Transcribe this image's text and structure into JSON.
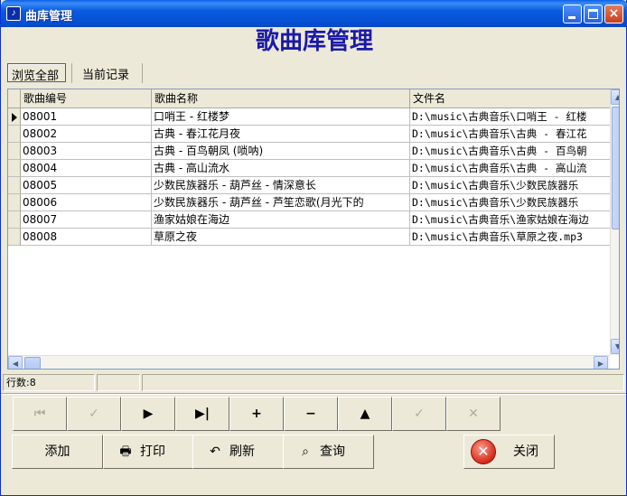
{
  "window": {
    "title": "曲库管理",
    "app_icon": "music-app-icon",
    "controls": {
      "minimize": "minimize-icon",
      "maximize": "maximize-icon",
      "close": "×"
    }
  },
  "heading": "歌曲库管理",
  "tabs": [
    {
      "label": "浏览全部",
      "active": true
    },
    {
      "label": "当前记录",
      "active": false
    }
  ],
  "grid": {
    "columns": [
      "歌曲编号",
      "歌曲名称",
      "文件名"
    ],
    "rows": [
      {
        "id": "08001",
        "name": "口哨王 - 红楼梦",
        "file": "D:\\music\\古典音乐\\口哨王 - 红楼"
      },
      {
        "id": "08002",
        "name": "古典 - 春江花月夜",
        "file": "D:\\music\\古典音乐\\古典 - 春江花"
      },
      {
        "id": "08003",
        "name": "古典 - 百鸟朝凤 (唢呐)",
        "file": "D:\\music\\古典音乐\\古典 - 百鸟朝"
      },
      {
        "id": "08004",
        "name": "古典 - 高山流水",
        "file": "D:\\music\\古典音乐\\古典 - 高山流"
      },
      {
        "id": "08005",
        "name": "少数民族器乐 - 葫芦丝 - 情深意长",
        "file": "D:\\music\\古典音乐\\少数民族器乐"
      },
      {
        "id": "08006",
        "name": "少数民族器乐 - 葫芦丝 - 芦笙恋歌(月光下的",
        "file": "D:\\music\\古典音乐\\少数民族器乐"
      },
      {
        "id": "08007",
        "name": "渔家姑娘在海边",
        "file": "D:\\music\\古典音乐\\渔家姑娘在海边"
      },
      {
        "id": "08008",
        "name": "草原之夜",
        "file": "D:\\music\\古典音乐\\草原之夜.mp3"
      }
    ],
    "current_row": 0
  },
  "status": {
    "row_count": "行数:8"
  },
  "navigator": [
    {
      "icon": "first-record-icon",
      "glyph": "⏮",
      "enabled": false
    },
    {
      "icon": "prior-record-icon",
      "glyph": "✓",
      "enabled": false
    },
    {
      "icon": "next-record-icon",
      "glyph": "▶",
      "enabled": true
    },
    {
      "icon": "last-record-icon",
      "glyph": "▶|",
      "enabled": true
    },
    {
      "icon": "insert-record-icon",
      "glyph": "+",
      "enabled": true
    },
    {
      "icon": "delete-record-icon",
      "glyph": "−",
      "enabled": true
    },
    {
      "icon": "edit-record-icon",
      "glyph": "▲",
      "enabled": true
    },
    {
      "icon": "post-record-icon",
      "glyph": "✓",
      "enabled": false
    },
    {
      "icon": "cancel-record-icon",
      "glyph": "✕",
      "enabled": false
    }
  ],
  "actions": {
    "add": "添加",
    "print": "打印",
    "refresh": "刷新",
    "query": "查询",
    "close": "关闭"
  },
  "action_icons": {
    "print": "🖶",
    "refresh": "↶",
    "query": "⌕",
    "close": "✕"
  }
}
